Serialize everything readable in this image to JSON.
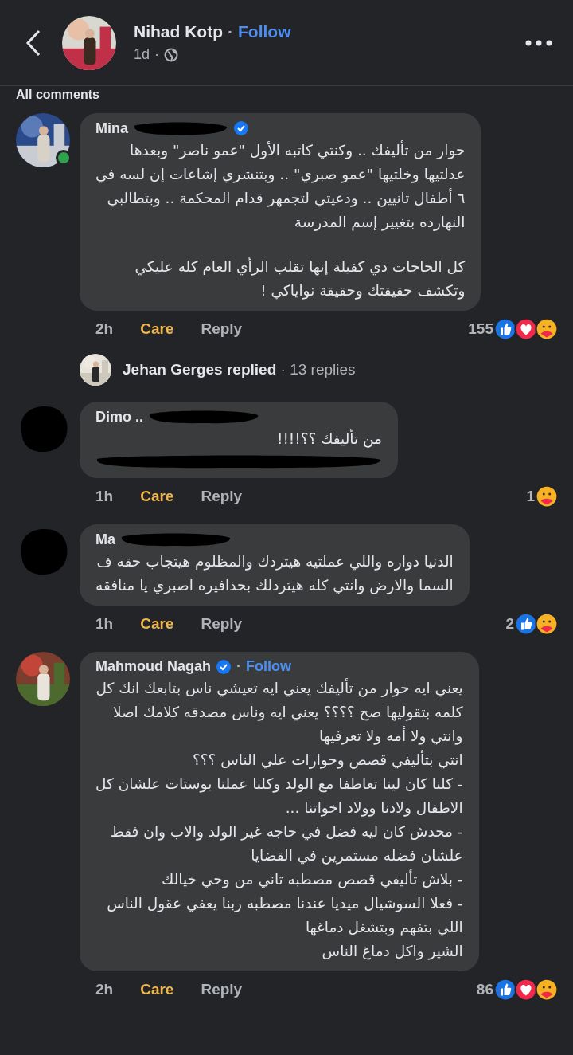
{
  "header": {
    "author": "Nihad Kotp",
    "follow": "Follow",
    "time": "1d",
    "separator": "·"
  },
  "section": {
    "title": "All comments"
  },
  "comments": [
    {
      "author": "Mina",
      "avatar": {
        "kind": "picture"
      },
      "online": true,
      "verified": true,
      "redacted_name": true,
      "paragraphs": [
        "حوار من تأليفك .. وكنتي كاتبه الأول \"عمو ناصر\" وبعدها\nعدلتيها وخلتيها \"عمو صبري\" .. وبتنشري إشاعات إن لسه في\n٦ أطفال تانيين .. ودعيتي لتجمهر قدام المحكمة .. وبتطالبي\nالنهارده بتغيير إسم المدرسة",
        "كل الحاجات دي كفيلة إنها تقلب الرأي العام كله عليكي\nوتكشف حقيقتك وحقيقة نواياكي !"
      ],
      "redacted_line": false,
      "time": "2h",
      "reaction_label": "Care",
      "reply": "Reply",
      "count": "155",
      "reactions": [
        {
          "kind": "like"
        },
        {
          "kind": "love"
        },
        {
          "kind": "care"
        }
      ],
      "replies": {
        "author": "Jehan Gerges",
        "verb": "replied",
        "count": "13 replies"
      }
    },
    {
      "author": "Dimo ..",
      "avatar": {
        "kind": "redacted"
      },
      "online": false,
      "verified": false,
      "redacted_name": true,
      "paragraphs": [
        "من تأليفك ؟؟!!!!"
      ],
      "redacted_line": true,
      "time": "1h",
      "reaction_label": "Care",
      "reply": "Reply",
      "count": "1",
      "reactions": [
        {
          "kind": "care"
        }
      ]
    },
    {
      "author": "Ma",
      "avatar": {
        "kind": "redacted"
      },
      "online": false,
      "verified": false,
      "redacted_name": true,
      "paragraphs": [
        "الدنيا دواره واللي عملتيه هيتردك والمظلوم هيتجاب حقه ف\nالسما والارض وانتي كله هيتردلك بحذافيره اصبري يا منافقه"
      ],
      "redacted_line": false,
      "time": "1h",
      "reaction_label": "Care",
      "reply": "Reply",
      "count": "2",
      "reactions": [
        {
          "kind": "like"
        },
        {
          "kind": "care"
        }
      ]
    },
    {
      "author": "Mahmoud Nagah",
      "avatar": {
        "kind": "picture"
      },
      "online": false,
      "verified": true,
      "redacted_name": false,
      "follow": "Follow",
      "paragraphs": [
        "يعني ايه حوار من تأليفك يعني ايه تعيشي ناس بتابعك انك كل\nكلمه بتقوليها صح ؟؟؟؟ يعني ايه وناس مصدقه كلامك اصلا\nوانتي ولا أمه ولا تعرفيها\nانتي بتأليفي قصص وحوارات علي الناس ؟؟؟\n- كلنا كان لينا تعاطفا مع الولد وكلنا عملنا بوستات علشان كل\nالاطفال ولادنا وولاد اخواتنا ...\n- محدش كان ليه فضل في حاجه غير الولد والاب وان فقط\nعلشان فضله مستمرين في القضايا\n- بلاش تأليفي قصص مصطبه تاني من وحي خيالك\n- فعلا السوشيال ميديا عندنا مصطبه ربنا يعفي عقول الناس\nاللي بتفهم وبتشغل دماغها\nالشير واكل دماغ الناس"
      ],
      "redacted_line": false,
      "time": "2h",
      "reaction_label": "Care",
      "reply": "Reply",
      "count": "86",
      "reactions": [
        {
          "kind": "like"
        },
        {
          "kind": "love"
        },
        {
          "kind": "care"
        }
      ]
    }
  ]
}
